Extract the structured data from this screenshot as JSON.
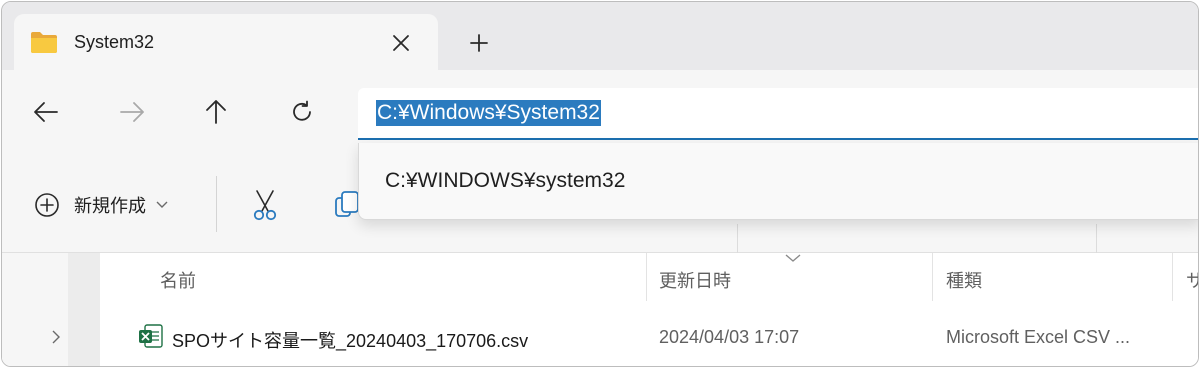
{
  "tab": {
    "title": "System32",
    "folder_icon": "folder-icon",
    "close_icon": "close-icon"
  },
  "toolbar": {
    "new_tab_icon": "plus-icon",
    "back_icon": "arrow-left-icon",
    "forward_icon": "arrow-right-icon",
    "up_icon": "arrow-up-icon",
    "refresh_icon": "refresh-icon"
  },
  "address": {
    "value": "C:¥Windows¥System32",
    "suggestion": "C:¥WINDOWS¥system32"
  },
  "commands": {
    "new_label": "新規作成",
    "new_icon": "plus-circle-icon",
    "cut_icon": "scissors-icon",
    "copy_icon": "copy-icon"
  },
  "columns": {
    "name": "名前",
    "modified": "更新日時",
    "type": "種類",
    "size_clipped": "サ"
  },
  "files": [
    {
      "name": "SPOサイト容量一覧_20240403_170706.csv",
      "modified": "2024/04/03 17:07",
      "type": "Microsoft Excel CSV ...",
      "icon": "excel-csv-icon"
    }
  ],
  "colors": {
    "accent": "#1c6fb0",
    "selection": "#2b7bbf",
    "excel_green": "#1e7145",
    "folder_yellow": "#f5c23a"
  }
}
